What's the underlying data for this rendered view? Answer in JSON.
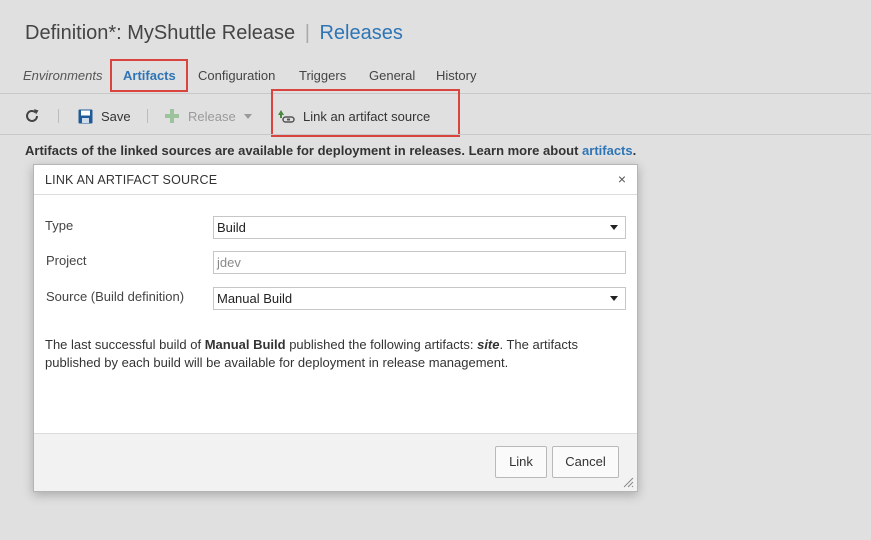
{
  "header": {
    "title": "Definition*: MyShuttle Release",
    "separator": "|",
    "link": "Releases"
  },
  "tabs": [
    {
      "label": "Environments"
    },
    {
      "label": "Artifacts"
    },
    {
      "label": "Configuration"
    },
    {
      "label": "Triggers"
    },
    {
      "label": "General"
    },
    {
      "label": "History"
    }
  ],
  "toolbar": {
    "refresh_icon": "refresh-icon",
    "save_label": "Save",
    "release_label": "Release",
    "link_source_label": "Link an artifact source"
  },
  "info": {
    "text": "Artifacts of the linked sources are available for deployment in releases. Learn more about",
    "link": "artifacts",
    "period": "."
  },
  "dialog": {
    "title": "LINK AN ARTIFACT SOURCE",
    "close_glyph": "×",
    "type_label": "Type",
    "type_value": "Build",
    "project_label": "Project",
    "project_value": "jdev",
    "source_label": "Source (Build definition)",
    "source_value": "Manual Build",
    "desc_prefix": "The last successful build of ",
    "desc_build": "Manual Build",
    "desc_middle": " published the following artifacts: ",
    "desc_artifact": "site",
    "desc_suffix": ". The artifacts published by each build will be available for deployment in release management.",
    "link_button": "Link",
    "cancel_button": "Cancel"
  },
  "colors": {
    "accent": "#2e75b6",
    "highlight_border": "#d9453e",
    "save_icon": "#1f5b99",
    "release_plus": "#9cc39c"
  }
}
